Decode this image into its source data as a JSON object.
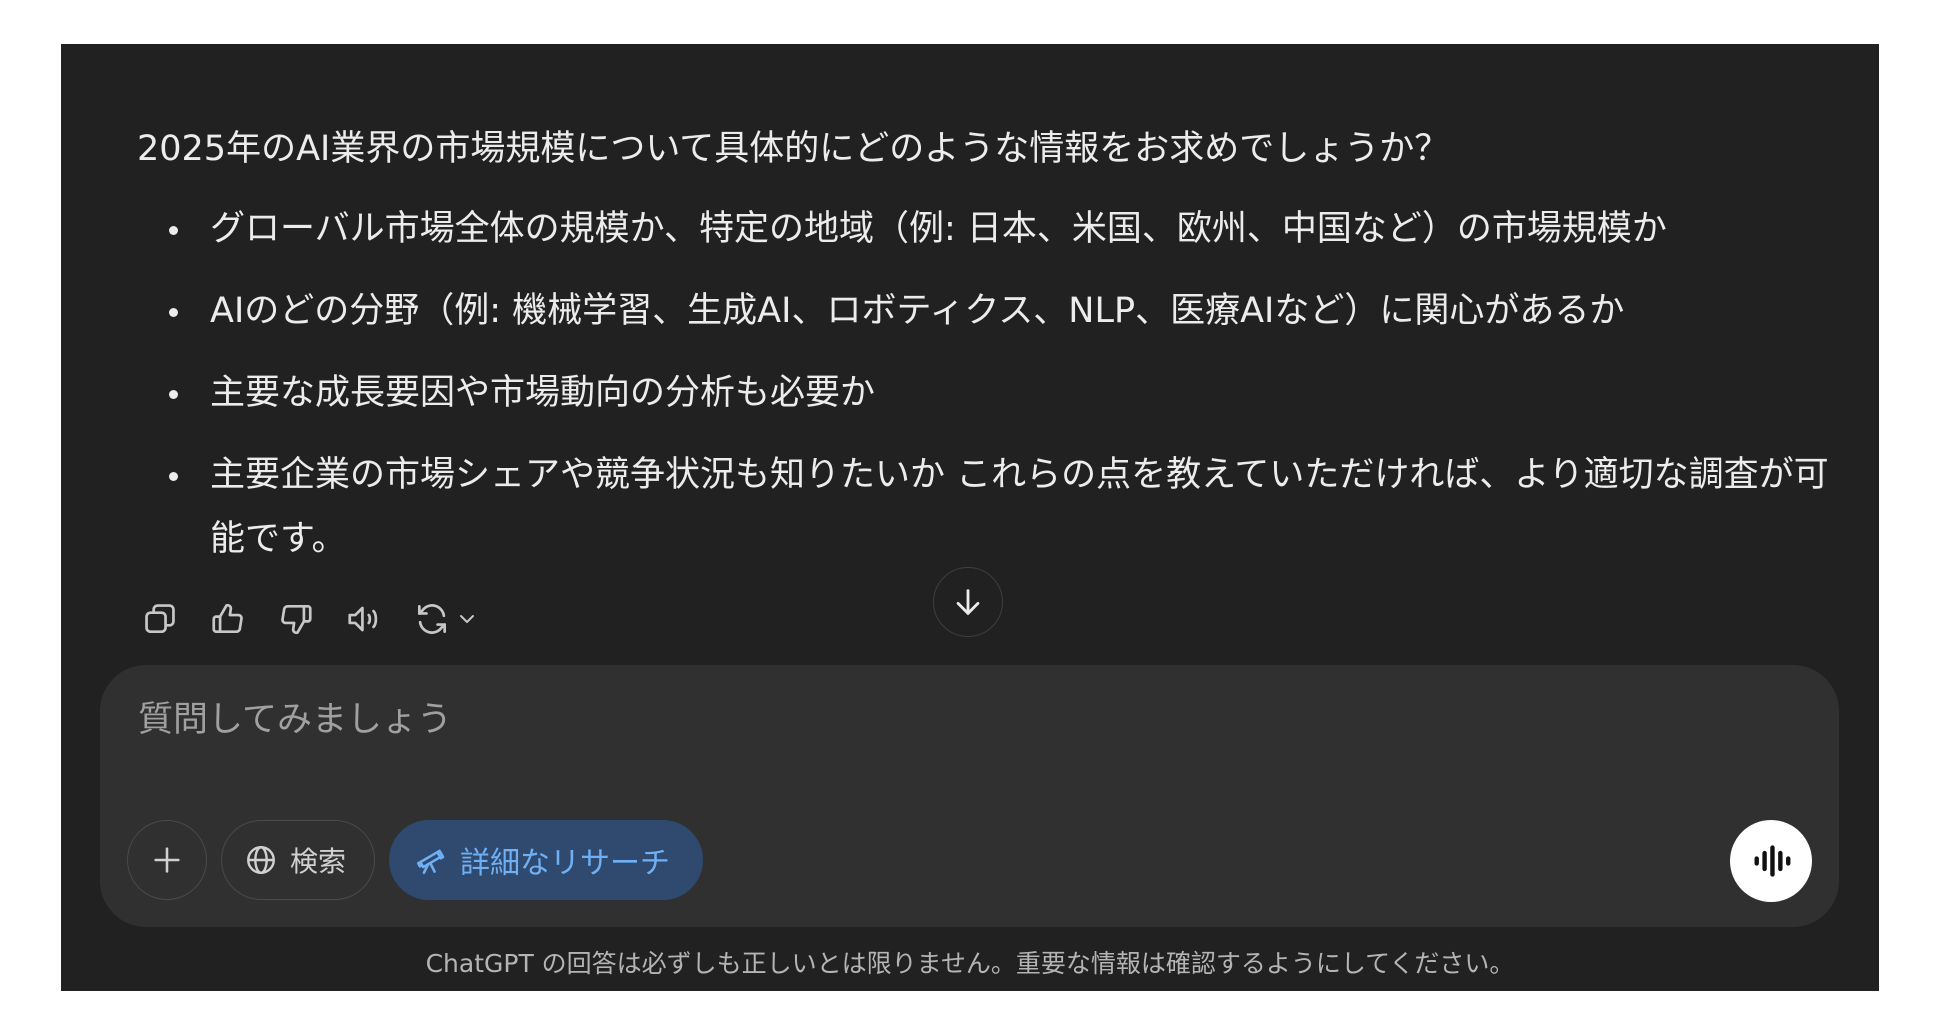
{
  "message": {
    "intro": "2025年のAI業界の市場規模について具体的にどのような情報をお求めでしょうか？",
    "bullets": [
      "グローバル市場全体の規模か、特定の地域（例: 日本、米国、欧州、中国など）の市場規模か",
      "AIのどの分野（例: 機械学習、生成AI、ロボティクス、NLP、医療AIなど）に関心があるか",
      "主要な成長要因や市場動向の分析も必要か",
      "主要企業の市場シェアや競争状況も知りたいか これらの点を教えていただければ、より適切な調査が可能です。"
    ]
  },
  "actions": {
    "icons": [
      "copy-icon",
      "thumbs-up-icon",
      "thumbs-down-icon",
      "speaker-icon",
      "regenerate-icon",
      "chevron-down-icon"
    ]
  },
  "composer": {
    "placeholder": "質問してみましょう",
    "search_label": "検索",
    "deep_research_label": "詳細なリサーチ",
    "accent_color": "#6fb0f5"
  },
  "disclaimer": "ChatGPT の回答は必ずしも正しいとは限りません。重要な情報は確認するようにしてください。"
}
